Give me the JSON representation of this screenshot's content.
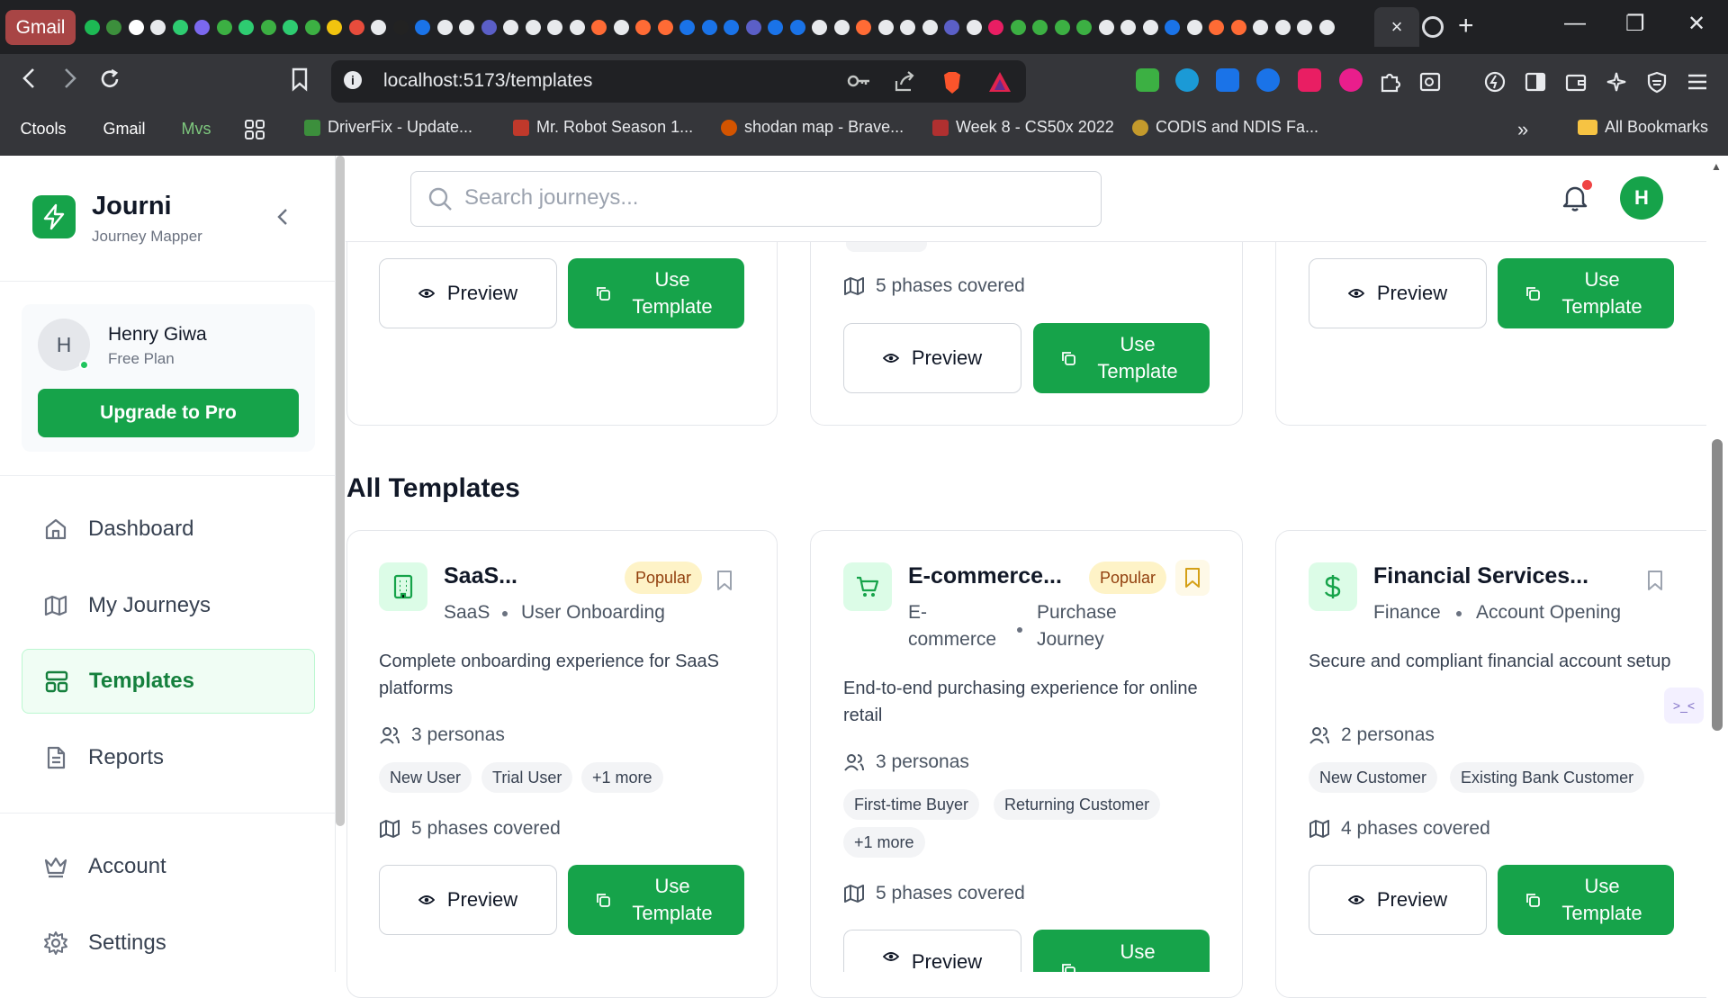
{
  "browser": {
    "gmail_tab": "Gmail",
    "active_tab_close": "×",
    "new_tab": "+",
    "url": "localhost:5173/templates",
    "window_controls": [
      "—",
      "❐",
      "✕"
    ],
    "bookmark_chips": [
      {
        "label": "Ctools",
        "color": "#5f6368"
      },
      {
        "label": "Gmail",
        "color": "#a84545"
      },
      {
        "label": "Mvs",
        "color": "#4d6b4d"
      }
    ],
    "bookmarks": [
      {
        "label": "DriverFix - Update...",
        "icon_color": "#3c8f3c"
      },
      {
        "label": "Mr. Robot Season 1...",
        "icon_color": "#c0392b"
      },
      {
        "label": "shodan map - Brave...",
        "icon_color": "#d35400"
      },
      {
        "label": "Week 8 - CS50x 2022",
        "icon_color": "#b03030"
      },
      {
        "label": "CODIS and NDIS Fa...",
        "icon_color": "#c49a2c"
      }
    ],
    "more_bookmarks": "»",
    "all_bookmarks": "All Bookmarks"
  },
  "sidebar": {
    "app_name": "Journi",
    "app_subtitle": "Journey Mapper",
    "collapse": "‹",
    "user": {
      "initial": "H",
      "name": "Henry Giwa",
      "plan": "Free Plan"
    },
    "upgrade_label": "Upgrade to Pro",
    "nav": [
      {
        "label": "Dashboard",
        "icon": "home-icon"
      },
      {
        "label": "My Journeys",
        "icon": "map-icon"
      },
      {
        "label": "Templates",
        "icon": "layout-icon",
        "active": true
      },
      {
        "label": "Reports",
        "icon": "file-icon"
      },
      {
        "label": "Account",
        "icon": "crown-icon"
      },
      {
        "label": "Settings",
        "icon": "gear-icon"
      }
    ]
  },
  "header": {
    "search_placeholder": "Search journeys...",
    "user_initial": "H"
  },
  "featured": {
    "col1": {
      "preview": "Preview",
      "use": "Use Template"
    },
    "col2": {
      "phases": "5 phases covered",
      "preview": "Preview",
      "use": "Use Template"
    },
    "col3": {
      "preview": "Preview",
      "use": "Use Template"
    }
  },
  "all_templates": {
    "title": "All Templates",
    "cards": [
      {
        "title": "SaaS...",
        "badge": "Popular",
        "category": "SaaS",
        "type": "User Onboarding",
        "description": "Complete onboarding experience for SaaS platforms",
        "personas": "3 personas",
        "tags": [
          "New User",
          "Trial User",
          "+1 more"
        ],
        "phases": "5 phases covered",
        "preview": "Preview",
        "use": "Use Template"
      },
      {
        "title": "E-commerce...",
        "badge": "Popular",
        "category": "E-commerce",
        "type": "Purchase Journey",
        "description": "End-to-end purchasing experience for online retail",
        "personas": "3 personas",
        "tags": [
          "First-time Buyer",
          "Returning Customer",
          "+1 more"
        ],
        "phases": "5 phases covered",
        "preview": "Preview",
        "use": "Use"
      },
      {
        "title": "Financial Services...",
        "category": "Finance",
        "type": "Account Opening",
        "description": "Secure and compliant financial account setup",
        "personas": "2 personas",
        "tags": [
          "New Customer",
          "Existing Bank Customer"
        ],
        "phases": "4 phases covered",
        "preview": "Preview",
        "use": "Use Template"
      }
    ]
  },
  "colors": {
    "brand": "#16a34a",
    "badge_bg": "#fef3c7",
    "notification": "#ef4444"
  }
}
